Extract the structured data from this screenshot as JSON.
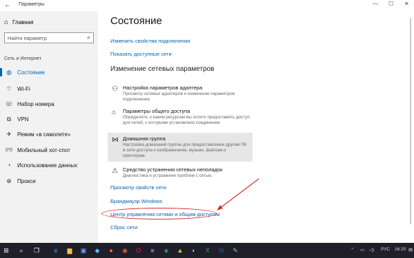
{
  "window": {
    "title": "Параметры",
    "minimize": "—",
    "maximize": "☐",
    "close": "✕"
  },
  "sidebar": {
    "home_label": "Главная",
    "search_placeholder": "Найти параметр",
    "section_label": "Сеть и Интернет",
    "items": [
      {
        "label": "Состояние",
        "icon": "globe-icon",
        "glyph": "◍",
        "active": true
      },
      {
        "label": "Wi-Fi",
        "icon": "wifi-icon",
        "glyph": "⌔",
        "active": false
      },
      {
        "label": "Набор номера",
        "icon": "dialup-icon",
        "glyph": "☏",
        "active": false
      },
      {
        "label": "VPN",
        "icon": "vpn-icon",
        "glyph": "⧉",
        "active": false
      },
      {
        "label": "Режим «в самолете»",
        "icon": "airplane-icon",
        "glyph": "✈",
        "active": false
      },
      {
        "label": "Мобильный хот-спот",
        "icon": "hotspot-icon",
        "glyph": "((•))",
        "active": false
      },
      {
        "label": "Использование данных",
        "icon": "data-usage-icon",
        "glyph": "◔",
        "active": false
      },
      {
        "label": "Прокси",
        "icon": "proxy-icon",
        "glyph": "⊕",
        "active": false
      }
    ]
  },
  "main": {
    "title": "Состояние",
    "links_top": [
      "Изменить свойства подключения",
      "Показать доступные сети"
    ],
    "subheading": "Изменение сетевых параметров",
    "options": [
      {
        "title": "Настройка параметров адаптера",
        "desc": "Просмотр сетевых адаптеров и изменение параметров подключения.",
        "icon": "adapter-icon",
        "glyph": "⚇"
      },
      {
        "title": "Параметры общего доступа",
        "desc": "Определите, к каким ресурсам вы хотите предоставить доступ для сетей, с которыми установлено соединение.",
        "icon": "sharing-icon",
        "glyph": "⌂"
      },
      {
        "title": "Домашняя группа",
        "desc": "Настройка домашней группы для предоставления другим ПК в сети доступа к изображениям, музыке, файлам и принтерам.",
        "icon": "homegroup-icon",
        "glyph": "⋈"
      },
      {
        "title": "Средство устранения сетевых неполадок",
        "desc": "Диагностика и устранение проблем с сетью.",
        "icon": "warning-icon",
        "glyph": "⚠"
      }
    ],
    "links_bottom": [
      "Просмотр свойств сети",
      "Брандмауэр Windows",
      "Центр управления сетями и общим доступом",
      "Сброс сети"
    ]
  },
  "taskbar": {
    "lang": "РУС",
    "time": "16:20",
    "items": [
      {
        "icon": "start-icon",
        "glyph": "⊞",
        "color": "#ffffff"
      },
      {
        "icon": "search-icon",
        "glyph": "⌕",
        "color": "#ffffff"
      },
      {
        "icon": "task-view-icon",
        "glyph": "❐",
        "color": "#ffffff"
      },
      {
        "icon": "edge-icon",
        "glyph": "e",
        "color": "#3aa0ff"
      },
      {
        "icon": "folder-icon",
        "glyph": "▆",
        "color": "#f2c14e"
      },
      {
        "icon": "store-icon",
        "glyph": "▣",
        "color": "#6aa0ff"
      },
      {
        "icon": "app-icon-1",
        "glyph": "◆",
        "color": "#4fc3f7"
      },
      {
        "icon": "app-icon-2",
        "glyph": "●",
        "color": "#ff7043"
      },
      {
        "icon": "app-icon-3",
        "glyph": "◉",
        "color": "#ef5350"
      },
      {
        "icon": "opera-icon",
        "glyph": "O",
        "color": "#ff1744"
      },
      {
        "icon": "app-icon-4",
        "glyph": "■",
        "color": "#ab47bc"
      },
      {
        "icon": "app-icon-5",
        "glyph": "◈",
        "color": "#26a69a"
      },
      {
        "icon": "app-icon-6",
        "glyph": "▲",
        "color": "#ffca28"
      },
      {
        "icon": "app-icon-7",
        "glyph": "◐",
        "color": "#90caf9"
      },
      {
        "icon": "excel-icon",
        "glyph": "X",
        "color": "#21a366"
      },
      {
        "icon": "word-icon",
        "glyph": "W",
        "color": "#2b579a"
      },
      {
        "icon": "app-icon-8",
        "glyph": "✎",
        "color": "#bdbdbd"
      }
    ]
  },
  "colors": {
    "accent": "#0063b1",
    "annotation": "#d32f2f"
  }
}
